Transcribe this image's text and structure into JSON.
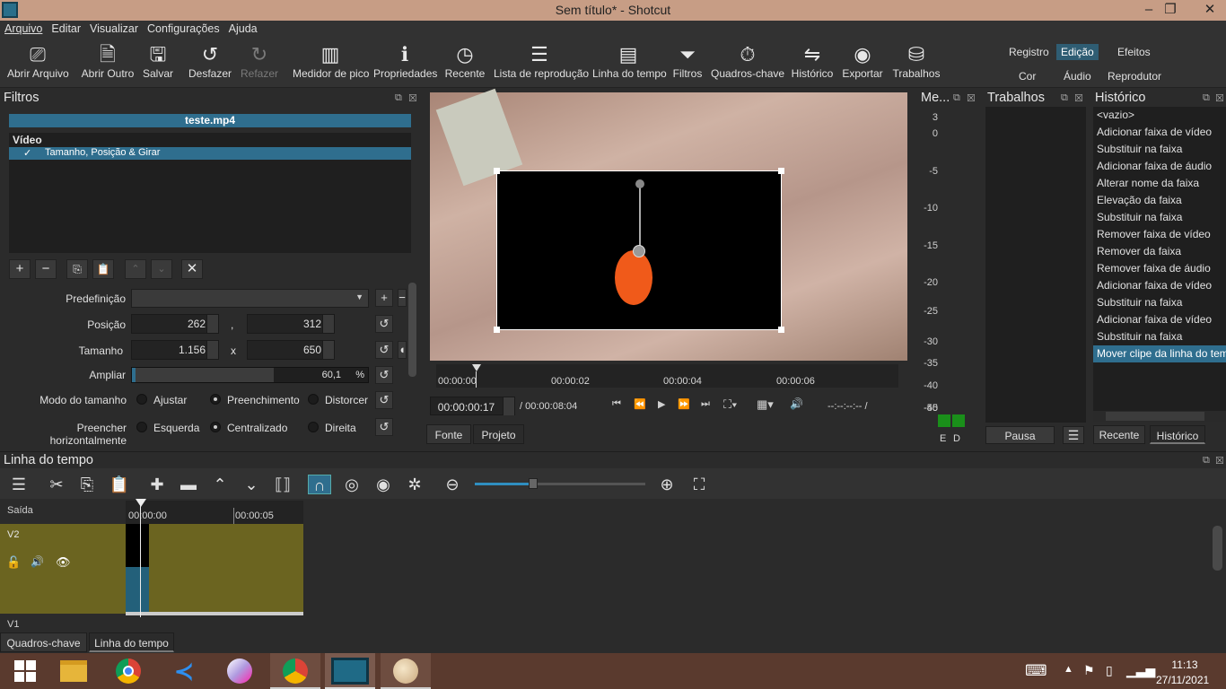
{
  "window": {
    "title": "Sem título* - Shotcut"
  },
  "menu": [
    "Arquivo",
    "Editar",
    "Visualizar",
    "Configurações",
    "Ajuda"
  ],
  "toolbar": {
    "open_file": "Abrir Arquivo",
    "open_other": "Abrir Outro",
    "save": "Salvar",
    "undo": "Desfazer",
    "redo": "Refazer",
    "peak_meter": "Medidor de pico",
    "properties": "Propriedades",
    "recent": "Recente",
    "playlist": "Lista de reprodução",
    "timeline": "Linha do tempo",
    "filters": "Filtros",
    "keyframes": "Quadros-chave",
    "history": "Histórico",
    "export": "Exportar",
    "jobs": "Trabalhos"
  },
  "layouts": {
    "row1": [
      "Registro",
      "Edição",
      "Efeitos"
    ],
    "row2": [
      "Cor",
      "Áudio",
      "Reprodutor"
    ],
    "selected": "Edição"
  },
  "filters_panel": {
    "title": "Filtros",
    "clip_name": "teste.mp4",
    "section": "Vídeo",
    "filter_item": "Tamanho, Posição & Girar",
    "preset_label": "Predefinição",
    "position_label": "Posição",
    "position_x": "262",
    "position_sep": ",",
    "position_y": "312",
    "size_label": "Tamanho",
    "size_w": "1.156",
    "size_sep": "x",
    "size_h": "650",
    "zoom_label": "Ampliar",
    "zoom_value": "60,1",
    "zoom_unit": "%",
    "zoom_fraction": 0.601,
    "size_mode_label": "Modo do tamanho",
    "size_mode_options": [
      "Ajustar",
      "Preenchimento",
      "Distorcer"
    ],
    "size_mode_selected": "Preenchimento",
    "halign_label": "Preencher horizontalmente",
    "halign_options": [
      "Esquerda",
      "Centralizado",
      "Direita"
    ],
    "halign_selected": "Centralizado"
  },
  "player": {
    "ruler": [
      "00:00:00",
      "00:00:02",
      "00:00:04",
      "00:00:06"
    ],
    "current_time": "00:00:00:17",
    "total_time": "/ 00:00:08:04",
    "in_out": "--:--:--:-- /",
    "tabs": [
      "Fonte",
      "Projeto"
    ]
  },
  "meter": {
    "title": "Me...",
    "labels": [
      "3",
      "0",
      "-5",
      "-10",
      "-15",
      "-20",
      "-25",
      "-30",
      "-35",
      "-40",
      "-45",
      "-50"
    ],
    "channels": [
      "E",
      "D"
    ]
  },
  "jobs_panel": {
    "title": "Trabalhos",
    "pause": "Pausa"
  },
  "history_panel": {
    "title": "Histórico",
    "items": [
      "<vazio>",
      "Adicionar faixa de vídeo",
      "Substituir na faixa",
      "Adicionar faixa de áudio",
      "Alterar nome da faixa",
      "Elevação da faixa",
      "Substituir na faixa",
      "Remover faixa de vídeo",
      "Remover da faixa",
      "Remover faixa de áudio",
      "Adicionar faixa de vídeo",
      "Substituir na faixa",
      "Adicionar faixa de vídeo",
      "Substituir na faixa",
      "Mover clipe da linha do tempo"
    ],
    "selected_index": 14,
    "tabs": [
      "Recente",
      "Histórico"
    ]
  },
  "timeline": {
    "title": "Linha do tempo",
    "output_label": "Saída",
    "ruler": [
      "00:00:00",
      "00:00:05"
    ],
    "tracks": [
      "V2",
      "V1"
    ],
    "bottom_tabs": [
      "Quadros-chave",
      "Linha do tempo"
    ]
  },
  "taskbar": {
    "time": "11:13",
    "date": "27/11/2021"
  }
}
